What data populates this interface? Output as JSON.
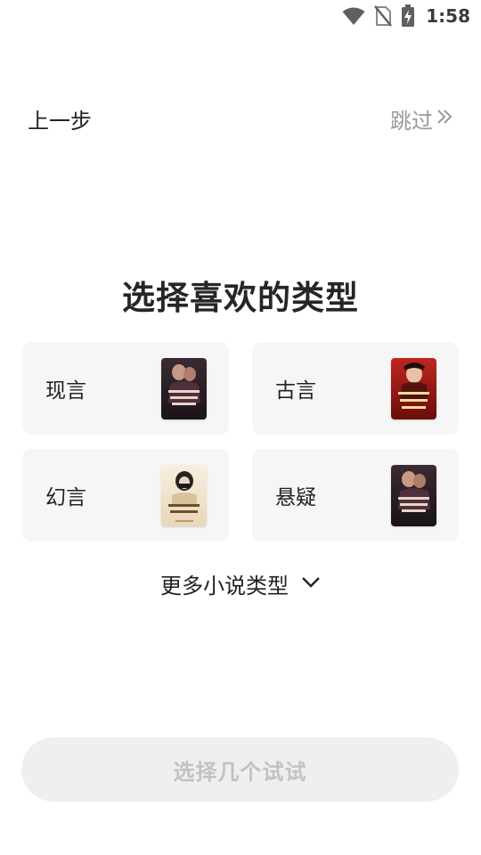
{
  "status_bar": {
    "time": "1:58",
    "icons": [
      "wifi-icon",
      "no-sim-icon",
      "battery-charging-icon"
    ]
  },
  "nav": {
    "back_label": "上一步",
    "skip_label": "跳过",
    "skip_icon": "double-chevron-right-icon"
  },
  "title": "选择喜欢的类型",
  "genres": [
    {
      "label": "现言",
      "cover_icon": "book-cover-image"
    },
    {
      "label": "古言",
      "cover_icon": "book-cover-image"
    },
    {
      "label": "幻言",
      "cover_icon": "book-cover-image"
    },
    {
      "label": "悬疑",
      "cover_icon": "book-cover-image"
    }
  ],
  "more": {
    "label": "更多小说类型",
    "icon": "chevron-down-icon"
  },
  "primary_button": {
    "label": "选择几个试试",
    "enabled": false
  },
  "colors": {
    "card_bg": "#f6f6f6",
    "button_disabled_bg": "#efefef",
    "button_disabled_text": "#c2c2c2",
    "muted_text": "#9a9a9a"
  }
}
